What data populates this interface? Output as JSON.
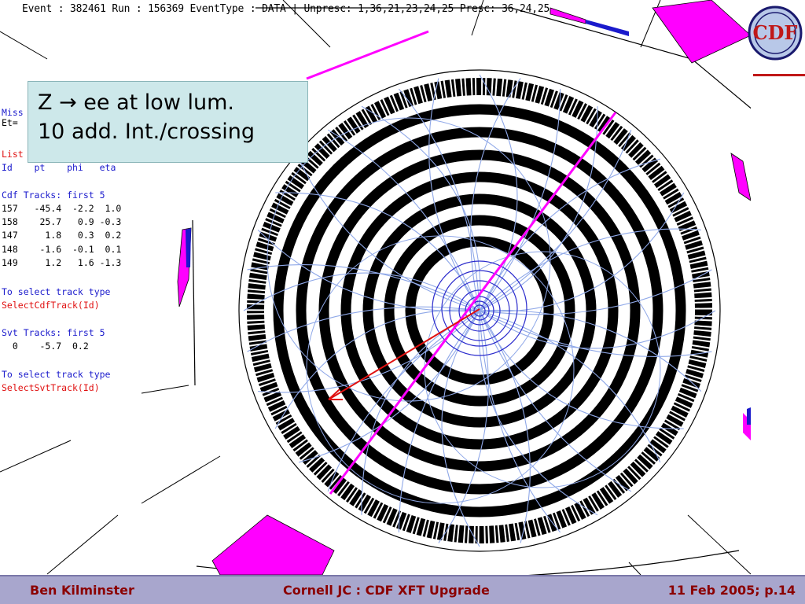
{
  "header": {
    "event_line": "Event : 382461  Run : 156369  EventType : DATA | Unpresc: 1,36,21,23,24,25 Presc: 36,24,25"
  },
  "left_panel": {
    "miss_label": "Miss",
    "et_label": "Et=",
    "list_label": "List",
    "columns": "Id    pt    phi   eta",
    "cdf_header": "Cdf Tracks: first 5",
    "cdf_rows": [
      "157   -45.4  -2.2  1.0",
      "158    25.7   0.9 -0.3",
      "147     1.8   0.3  0.2",
      "148    -1.6  -0.1  0.1",
      "149     1.2   1.6 -1.3"
    ],
    "select_hint_1": "To select track type",
    "select_cmd_1": "SelectCdfTrack(Id)",
    "svt_header": "Svt Tracks: first 5",
    "svt_row": "  0    -5.7  0.2",
    "select_hint_2": "To select track type",
    "select_cmd_2": "SelectSvtTrack(Id)"
  },
  "annotation": {
    "line1": "Z → ee at low lum.",
    "line2": "10 add. Int./crossing"
  },
  "logo_text": "CDF",
  "footer": {
    "left": "Ben Kilminster",
    "center": "Cornell JC : CDF XFT Upgrade",
    "right": "11 Feb 2005; p.14"
  },
  "colors": {
    "magenta": "#ff00ff",
    "track_blue": "#8fa8e8",
    "electron_red": "#e01010",
    "footer_bg": "#a8a6cd",
    "footer_text": "#8b0000",
    "annotation_bg": "#cde8ea"
  }
}
